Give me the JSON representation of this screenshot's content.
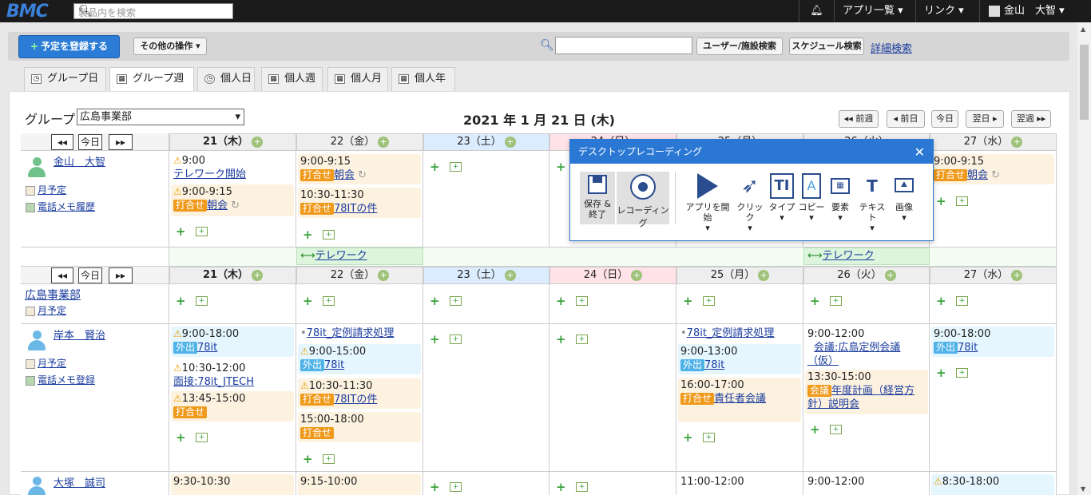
{
  "topbar": {
    "logo": "BMC",
    "search_placeholder": "製品内を検索",
    "apps_label": "アプリ一覧 ▾",
    "links_label": "リンク ▾",
    "user_label": "金山　大智 ▾",
    "bell_icon": "bell-icon"
  },
  "toolbar": {
    "register_label": "予定を登録する",
    "other_ops_label": "その他の操作 ▾",
    "user_facility_search": "ユーザー/施設検索",
    "schedule_search": "スケジュール検索",
    "advanced_search": "詳細検索"
  },
  "tabs": [
    "グループ日",
    "グループ週",
    "個人日",
    "個人週",
    "個人月",
    "個人年"
  ],
  "active_tab": "グループ週",
  "group_label": "グループ",
  "group_value": "広島事業部",
  "date_title": "2021 年 1 月 21 日 (木)",
  "date_nav": {
    "prev_week": "◂◂ 前週",
    "prev_day": "◂ 前日",
    "today": "今日",
    "next_day": "翌日 ▸",
    "next_week": "翌週 ▸▸"
  },
  "week_nav": {
    "prev": "◂◂",
    "today": "今日",
    "next": "▸▸"
  },
  "days": [
    "21（木）",
    "22（金）",
    "23（土）",
    "24（日）",
    "25（月）",
    "26（火）",
    "27（水）"
  ],
  "rows": {
    "kanayama": {
      "name": "金山　大智",
      "link1": "月予定",
      "link2": "電話メモ履歴",
      "thu_e1_time": "9:00",
      "thu_e1_title": "テレワーク開始",
      "thu_e2_time": "9:00-9:15",
      "thu_e2_tag": "打合せ",
      "thu_e2_title": "朝会",
      "fri_e1_time": "9:00-9:15",
      "fri_e1_tag": "打合せ",
      "fri_e1_title": "朝会",
      "fri_e2_time": "10:30-11:30",
      "fri_e2_tag": "打合せ",
      "fri_e2_title": "78ITの件",
      "wed_e1_time": "9:00-9:15",
      "wed_e1_tag": "打合せ",
      "wed_e1_title": "朝会"
    },
    "telework1": "テレワーク",
    "telework2": "テレワーク",
    "dept": {
      "name": "広島事業部",
      "link1": "月予定"
    },
    "kishimoto": {
      "name": "岸本　賢治",
      "link1": "月予定",
      "link2": "電話メモ登録",
      "thu_e1_time": "9:00-18:00",
      "thu_e1_tag": "外出",
      "thu_e1_title": "78it",
      "thu_e2_time": "10:30-12:00",
      "thu_e2_title": "面接:78it_JTECH",
      "thu_e3_time": "13:45-15:00",
      "thu_e3_tag": "打合せ",
      "fri_e0": "78it_定例請求処理",
      "fri_e1_time": "9:00-15:00",
      "fri_e1_tag": "外出",
      "fri_e1_title": "78it",
      "fri_e2_time": "10:30-11:30",
      "fri_e2_tag": "打合せ",
      "fri_e2_title": "78ITの件",
      "fri_e3_time": "15:00-18:00",
      "fri_e3_tag": "打合せ",
      "mon_e0": "78it_定例請求処理",
      "mon_e1_time": "9:00-13:00",
      "mon_e1_tag": "外出",
      "mon_e1_title": "78it",
      "mon_e2_time": "16:00-17:00",
      "mon_e2_tag": "打合せ",
      "mon_e2_title": "責任者会議",
      "tue_e1_time": "9:00-12:00",
      "tue_e1_title": "会議:広島定例会議（仮）",
      "tue_e2_time": "13:30-15:00",
      "tue_e2_tag": "会議",
      "tue_e2_title": "年度計画（経営方針）説明会",
      "wed_e1_time": "9:00-18:00",
      "wed_e1_tag": "外出",
      "wed_e1_title": "78it"
    },
    "otsuka": {
      "name": "大塚　誠司",
      "thu_e1_time": "9:30-10:30",
      "fri_e1_time": "9:15-10:00",
      "mon_e1_time": "11:00-12:00",
      "tue_e1_time": "9:00-12:00",
      "wed_e1_time": "8:30-18:00"
    }
  },
  "popup": {
    "title": "デスクトップレコーディング",
    "save": "保存 & 終了",
    "recording": "レコーディング",
    "tools": [
      "アプリを開始",
      "クリック",
      "タイプ",
      "コピー",
      "要素",
      "テキスト",
      "画像"
    ]
  }
}
